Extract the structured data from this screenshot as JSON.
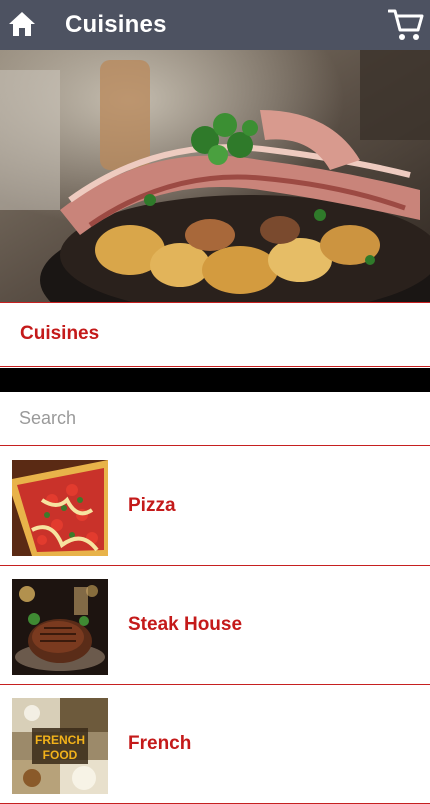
{
  "appbar": {
    "title": "Cuisines",
    "home_icon": "home-icon",
    "cart_icon": "shopping-cart-icon"
  },
  "section": {
    "title": "Cuisines"
  },
  "search": {
    "placeholder": "Search",
    "value": ""
  },
  "items": [
    {
      "label": "Pizza"
    },
    {
      "label": "Steak House"
    },
    {
      "label": "French"
    }
  ],
  "thumbnail_caption": {
    "french": "FRENCH FOOD"
  },
  "colors": {
    "appbar_bg": "#4d5261",
    "accent_red": "#c41a1a",
    "divider_red": "#c62020"
  }
}
